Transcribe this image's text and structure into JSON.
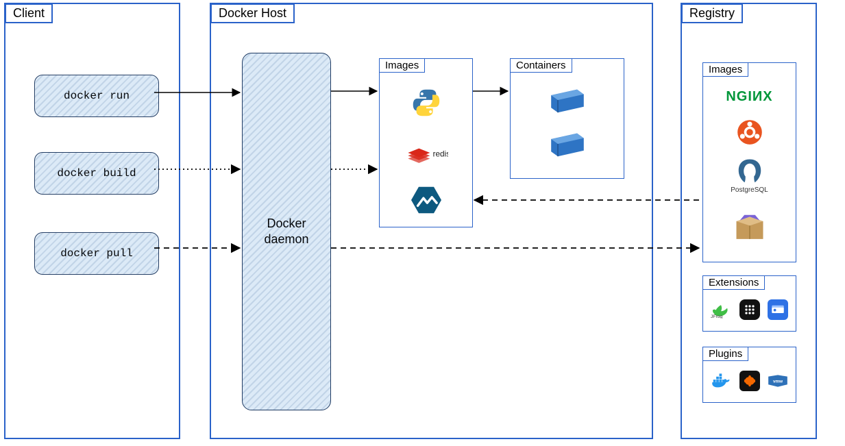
{
  "client": {
    "title": "Client",
    "commands": [
      "docker run",
      "docker build",
      "docker pull"
    ]
  },
  "host": {
    "title": "Docker Host",
    "daemon_label": "Docker\ndaemon",
    "images_title": "Images",
    "containers_title": "Containers",
    "image_icons": [
      "python",
      "redis",
      "alpine"
    ],
    "container_count": 2
  },
  "registry": {
    "title": "Registry",
    "images_title": "Images",
    "image_icons": [
      "nginx",
      "ubuntu",
      "postgresql",
      "package"
    ],
    "extensions_title": "Extensions",
    "extension_icons": [
      "jfrog",
      "portainer",
      "azure"
    ],
    "plugins_title": "Plugins",
    "plugin_icons": [
      "docker",
      "grafana",
      "vmware"
    ]
  },
  "arrows": [
    {
      "from": "client.run",
      "to": "daemon",
      "style": "solid"
    },
    {
      "from": "daemon",
      "to": "host.images",
      "style": "solid",
      "context": "run"
    },
    {
      "from": "host.images",
      "to": "host.containers",
      "style": "solid",
      "context": "run"
    },
    {
      "from": "client.build",
      "to": "daemon",
      "style": "dotted"
    },
    {
      "from": "daemon",
      "to": "host.images",
      "style": "dotted",
      "context": "build"
    },
    {
      "from": "client.pull",
      "to": "daemon",
      "style": "dashed"
    },
    {
      "from": "daemon",
      "to": "registry.images",
      "style": "dashed",
      "context": "pull",
      "bidirectional": true
    },
    {
      "from": "registry.images",
      "to": "host.images",
      "style": "dashed",
      "context": "pull"
    }
  ],
  "colors": {
    "panel_border": "#2a62c9",
    "sketch_fill": "#dceaf7",
    "container_blue": "#2e74c4",
    "nginx_green": "#009639",
    "ubuntu_orange": "#e95420",
    "postgres_blue": "#336791",
    "redis_red": "#d9281a",
    "python_blue": "#3776ab",
    "python_yellow": "#ffd43b",
    "alpine_blue": "#0d597f",
    "jfrog_green": "#40be46",
    "grafana_orange": "#f46800",
    "docker_blue": "#2496ed",
    "vmware_blue": "#2e71b8"
  }
}
